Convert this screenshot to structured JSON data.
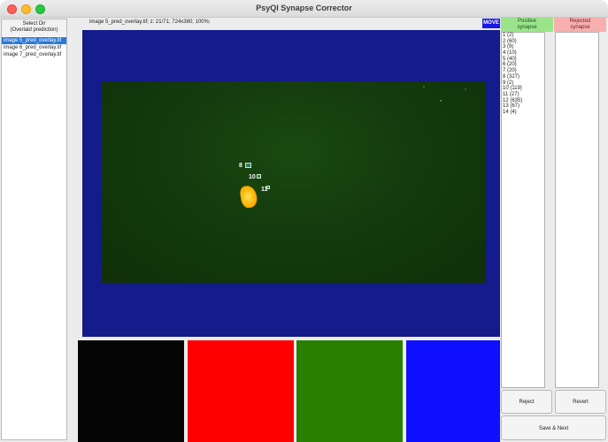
{
  "window": {
    "title": "PsyQI Synapse Corrector"
  },
  "file_panel": {
    "select_dir_label": "Select Dir\n(Overlaid prediction)",
    "files": [
      {
        "name": "image 5_pred_overlay.tif",
        "selected": true
      },
      {
        "name": "image 6_pred_overlay.tif",
        "selected": false
      },
      {
        "name": "image 7_pred_overlay.tif",
        "selected": false
      }
    ]
  },
  "viewer": {
    "image_info": "image 5_pred_overlay.tif; z: 21/71; 724x380; 100%;",
    "move_label": "MOVE",
    "synapse_labels": [
      "8",
      "10",
      "11"
    ]
  },
  "colors": {
    "swatch_black": "#000000",
    "swatch_red": "#ff0000",
    "swatch_green": "#298000",
    "swatch_blue": "#0f0fff",
    "canvas_background": "#141b8a",
    "positive_header": "#9be48c",
    "rejected_header": "#f7b0b0"
  },
  "positive": {
    "header": "Positive\nsynapse",
    "items": [
      "1 (2)",
      "2 (60)",
      "3 (9)",
      "4 (10)",
      "5 (40)",
      "6 (20)",
      "7 (20)",
      "8 (327)",
      "9 (2)",
      "10 (119)",
      "11 (27)",
      "12 (635)",
      "13 (67)",
      "14 (4)"
    ]
  },
  "rejected": {
    "header": "Rejected\nsynapse",
    "items": []
  },
  "actions": {
    "reject_label": "Reject",
    "revert_label": "Revert",
    "save_next_label": "Save & Next"
  }
}
